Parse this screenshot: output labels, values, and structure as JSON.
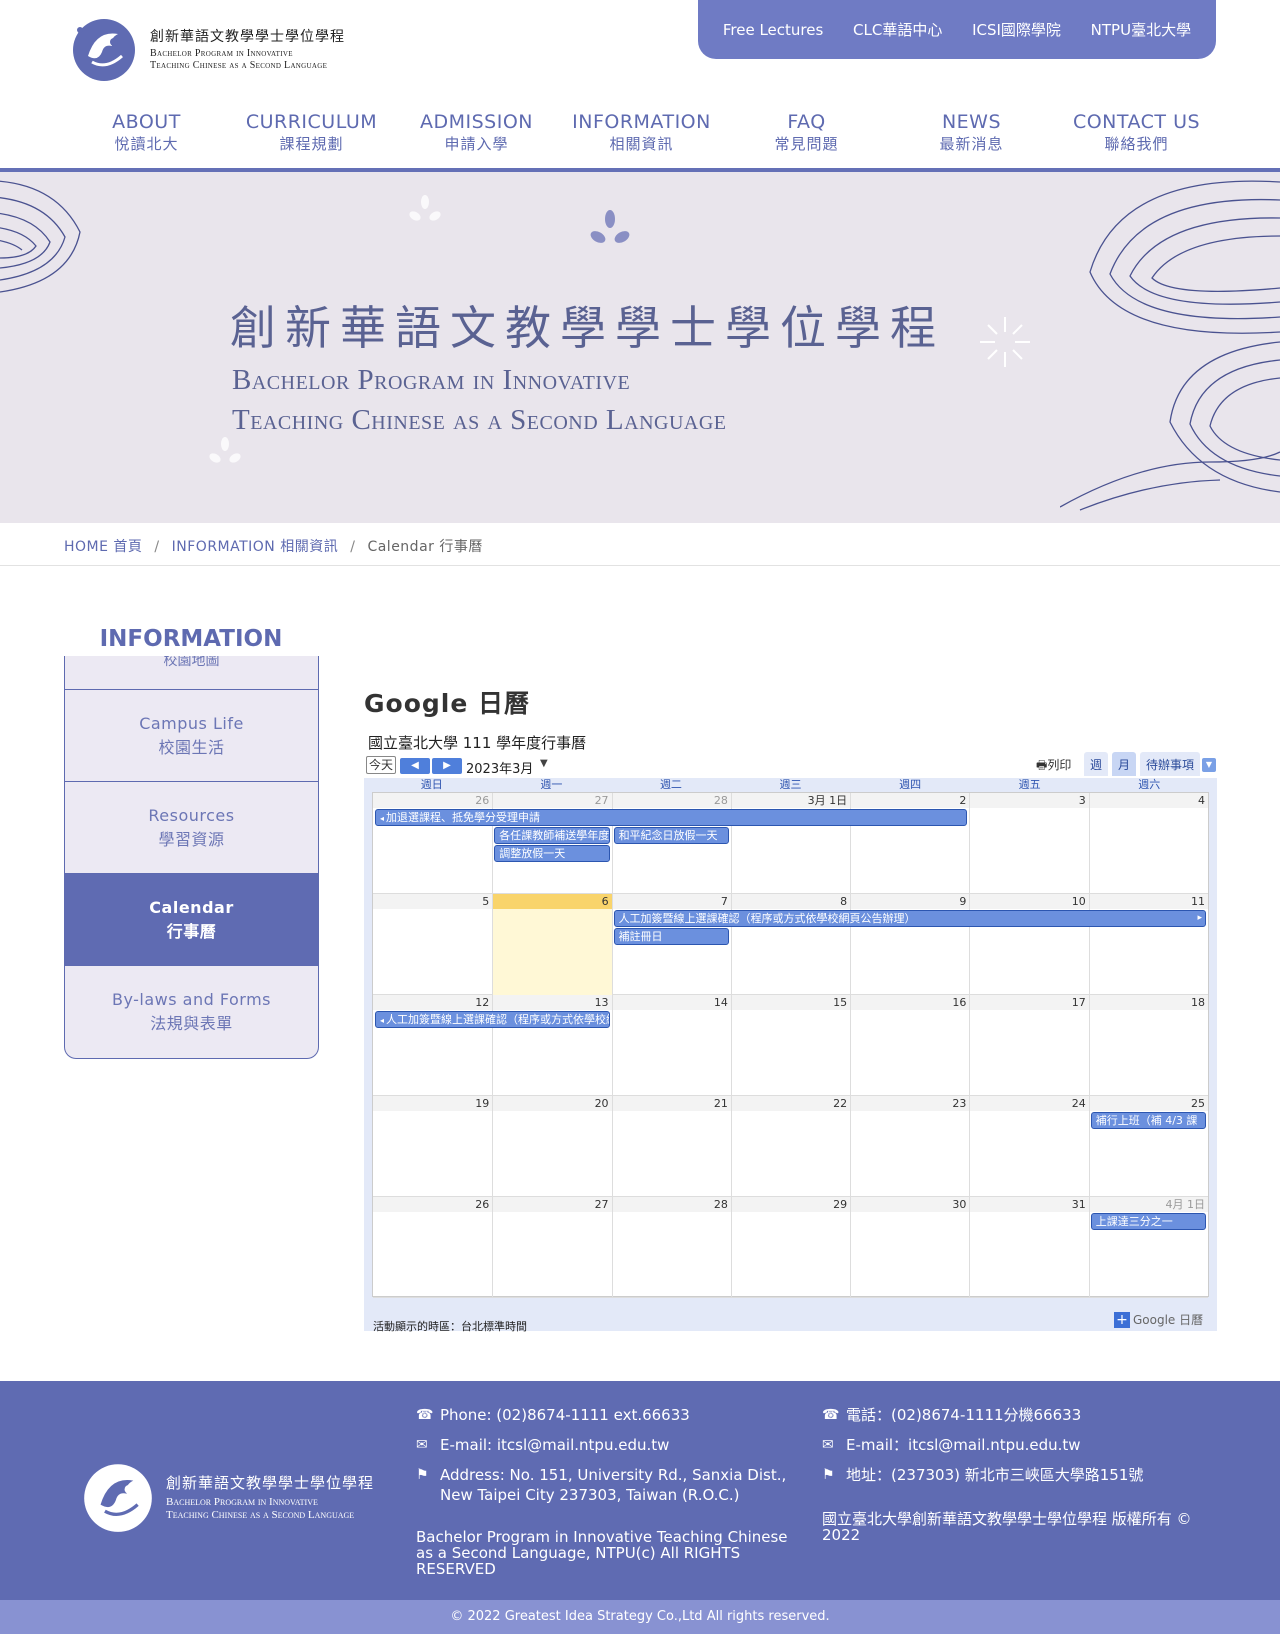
{
  "header": {
    "logo_zh": "創新華語文教學學士學位學程",
    "logo_en_line1": "Bachelor Program in Innovative",
    "logo_en_line2": "Teaching Chinese as a Second Language",
    "top_links": [
      "Free Lectures",
      "CLC華語中心",
      "ICSI國際學院",
      "NTPU臺北大學"
    ],
    "nav": [
      {
        "en": "ABOUT",
        "zh": "悅讀北大"
      },
      {
        "en": "CURRICULUM",
        "zh": "課程規劃"
      },
      {
        "en": "ADMISSION",
        "zh": "申請入學"
      },
      {
        "en": "INFORMATION",
        "zh": "相關資訊"
      },
      {
        "en": "FAQ",
        "zh": "常見問題"
      },
      {
        "en": "NEWS",
        "zh": "最新消息"
      },
      {
        "en": "CONTACT US",
        "zh": "聯絡我們"
      }
    ]
  },
  "banner": {
    "title_zh": "創新華語文教學學士學位學程",
    "title_en_line1": "Bachelor Program in Innovative",
    "title_en_line2": "Teaching Chinese as a Second Language"
  },
  "breadcrumb": [
    "HOME 首頁",
    "INFORMATION 相關資訊",
    "Calendar 行事曆"
  ],
  "sidebar": {
    "title": "INFORMATION",
    "partial_item": "校園地圖",
    "items": [
      {
        "en": "Campus Life",
        "zh": "校園生活",
        "active": false
      },
      {
        "en": "Resources",
        "zh": "學習資源",
        "active": false
      },
      {
        "en": "Calendar",
        "zh": "行事曆",
        "active": true
      },
      {
        "en": "By-laws and Forms",
        "zh": "法規與表單",
        "active": false
      }
    ]
  },
  "calendar": {
    "heading": "Google 日曆",
    "name": "國立臺北大學 111 學年度行事曆",
    "today_btn": "今天",
    "month": "2023年3月",
    "print": "列印",
    "views": [
      "週",
      "月",
      "待辦事項"
    ],
    "weekdays": [
      "週日",
      "週一",
      "週二",
      "週三",
      "週四",
      "週五",
      "週六"
    ],
    "weeks": [
      [
        {
          "n": "26",
          "o": true
        },
        {
          "n": "27",
          "o": true
        },
        {
          "n": "28",
          "o": true
        },
        {
          "n": "3月 1日",
          "o": false
        },
        {
          "n": "2",
          "o": false
        },
        {
          "n": "3",
          "o": false
        },
        {
          "n": "4",
          "o": false
        }
      ],
      [
        {
          "n": "5",
          "o": false
        },
        {
          "n": "6",
          "o": false,
          "today": true
        },
        {
          "n": "7",
          "o": false
        },
        {
          "n": "8",
          "o": false
        },
        {
          "n": "9",
          "o": false
        },
        {
          "n": "10",
          "o": false
        },
        {
          "n": "11",
          "o": false
        }
      ],
      [
        {
          "n": "12",
          "o": false
        },
        {
          "n": "13",
          "o": false
        },
        {
          "n": "14",
          "o": false
        },
        {
          "n": "15",
          "o": false
        },
        {
          "n": "16",
          "o": false
        },
        {
          "n": "17",
          "o": false
        },
        {
          "n": "18",
          "o": false
        }
      ],
      [
        {
          "n": "19",
          "o": false
        },
        {
          "n": "20",
          "o": false
        },
        {
          "n": "21",
          "o": false
        },
        {
          "n": "22",
          "o": false
        },
        {
          "n": "23",
          "o": false
        },
        {
          "n": "24",
          "o": false
        },
        {
          "n": "25",
          "o": false
        }
      ],
      [
        {
          "n": "26",
          "o": false
        },
        {
          "n": "27",
          "o": false
        },
        {
          "n": "28",
          "o": false
        },
        {
          "n": "29",
          "o": false
        },
        {
          "n": "30",
          "o": false
        },
        {
          "n": "31",
          "o": false
        },
        {
          "n": "4月 1日",
          "o": true
        }
      ]
    ],
    "events": [
      {
        "week": 0,
        "start": 0,
        "span": 5,
        "row": 0,
        "title": "加退選課程、抵免學分受理申請",
        "cont_left": true
      },
      {
        "week": 0,
        "start": 1,
        "span": 1,
        "row": 1,
        "title": "各任課教師補送學年度",
        "cont_left": false
      },
      {
        "week": 0,
        "start": 2,
        "span": 1,
        "row": 1,
        "title": "和平紀念日放假一天",
        "cont_left": false
      },
      {
        "week": 0,
        "start": 1,
        "span": 1,
        "row": 2,
        "title": "調整放假一天",
        "cont_left": false
      },
      {
        "week": 1,
        "start": 2,
        "span": 5,
        "row": 0,
        "title": "人工加簽暨線上選課確認（程序或方式依學校網頁公告辦理）",
        "cont_right": true
      },
      {
        "week": 1,
        "start": 2,
        "span": 1,
        "row": 1,
        "title": "補註冊日",
        "cont_left": false
      },
      {
        "week": 2,
        "start": 0,
        "span": 2,
        "row": 0,
        "title": "人工加簽暨線上選課確認（程序或方式依學校網頁公告辦理）",
        "cont_left": true
      },
      {
        "week": 3,
        "start": 6,
        "span": 1,
        "row": 0,
        "title": "補行上班（補 4/3 課",
        "cont_left": false
      },
      {
        "week": 4,
        "start": 6,
        "span": 1,
        "row": 0,
        "title": "上課達三分之一",
        "cont_left": false
      }
    ],
    "timezone": "活動顯示的時區：台北標準時間",
    "badge": "Google 日曆"
  },
  "footer": {
    "logo_zh": "創新華語文教學學士學位學程",
    "logo_en_line1": "Bachelor Program in Innovative",
    "logo_en_line2": "Teaching Chinese as a Second Language",
    "phone_en": "Phone: (02)8674-1111 ext.66633",
    "email_en": "E-mail: itcsl@mail.ntpu.edu.tw",
    "address_en": "Address: No. 151, University Rd., Sanxia Dist., New Taipei City 237303, Taiwan (R.O.C.)",
    "copyright_en": "Bachelor Program in Innovative Teaching Chinese as a Second Language, NTPU(c) All RIGHTS RESERVED",
    "phone_zh": "電話：(02)8674-1111分機66633",
    "email_zh": "E-mail：itcsl@mail.ntpu.edu.tw",
    "address_zh": "地址：(237303) 新北市三峽區大學路151號",
    "copyright_zh": "國立臺北大學創新華語文教學學士學位學程 版權所有 © 2022",
    "bottom": "© 2022 Greatest Idea Strategy Co.,Ltd All rights reserved."
  },
  "colors": {
    "accent": "#5f6bb2",
    "event": "#6b90de",
    "today": "#f9d46b"
  }
}
